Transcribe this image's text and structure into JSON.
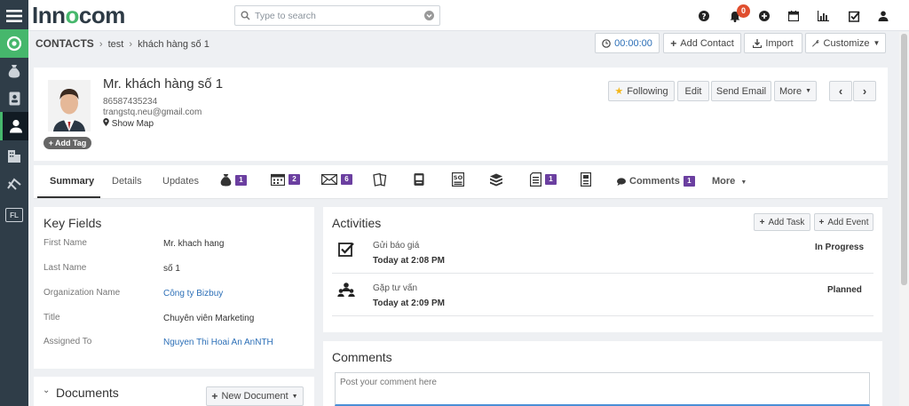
{
  "app": {
    "logo_prefix": "Inn",
    "logo_o": "o",
    "logo_suffix": "com"
  },
  "search": {
    "placeholder": "Type to search"
  },
  "topbar": {
    "notifications_count": "0"
  },
  "breadcrumb": {
    "module": "CONTACTS",
    "parent": "test",
    "current": "khách hàng số 1"
  },
  "actions": {
    "timer": "00:00:00",
    "add_contact": "Add Contact",
    "import": "Import",
    "customize": "Customize"
  },
  "contact": {
    "name": "Mr. khách hàng số 1",
    "phone": "86587435234",
    "email": "trangstq.neu@gmail.com",
    "show_map": "Show Map",
    "add_tag": "Add Tag"
  },
  "detail_buttons": {
    "following": "Following",
    "edit": "Edit",
    "send_email": "Send Email",
    "more": "More"
  },
  "tabs": {
    "summary": "Summary",
    "details": "Details",
    "updates": "Updates",
    "deals_count": "1",
    "calendar_count": "2",
    "email_count": "6",
    "docs_count": "1",
    "comments": "Comments",
    "comments_count": "1",
    "more": "More"
  },
  "key_fields": {
    "title": "Key Fields",
    "rows": [
      {
        "label": "First Name",
        "value": "Mr. khach hang"
      },
      {
        "label": "Last Name",
        "value": "số 1"
      },
      {
        "label": "Organization Name",
        "value": "Công ty Bizbuy"
      },
      {
        "label": "Title",
        "value": "Chuyên viên Marketing"
      },
      {
        "label": "Assigned To",
        "value": "Nguyen Thi Hoai An AnNTH"
      }
    ]
  },
  "documents": {
    "title": "Documents",
    "new_doc": "New Document"
  },
  "activities": {
    "title": "Activities",
    "add_task": "Add Task",
    "add_event": "Add Event",
    "items": [
      {
        "title": "Gửi báo giá",
        "time": "Today at 2:08 PM",
        "status": "In Progress"
      },
      {
        "title": "Gặp tư vấn",
        "time": "Today at 2:09 PM",
        "status": "Planned"
      }
    ]
  },
  "comments": {
    "title": "Comments",
    "placeholder": "Post your comment here"
  }
}
